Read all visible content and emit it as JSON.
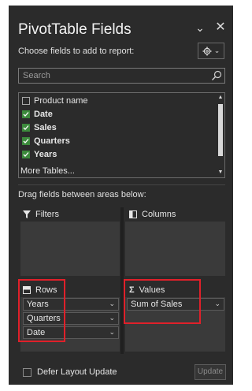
{
  "header": {
    "title": "PivotTable Fields",
    "subtitle": "Choose fields to add to report:"
  },
  "search": {
    "placeholder": "Search"
  },
  "fields": [
    {
      "label": "Product name",
      "checked": false
    },
    {
      "label": "Date",
      "checked": true
    },
    {
      "label": "Sales",
      "checked": true
    },
    {
      "label": "Quarters",
      "checked": true
    },
    {
      "label": "Years",
      "checked": true
    }
  ],
  "more_tables": "More Tables...",
  "drag_instruction": "Drag fields between areas below:",
  "areas": {
    "filters": {
      "label": "Filters"
    },
    "columns": {
      "label": "Columns"
    },
    "rows": {
      "label": "Rows",
      "items": [
        "Years",
        "Quarters",
        "Date"
      ]
    },
    "values": {
      "label": "Values",
      "items": [
        "Sum of Sales"
      ]
    }
  },
  "defer": {
    "label": "Defer Layout Update",
    "checked": false
  },
  "update_button": "Update",
  "colors": {
    "pane_bg": "#2b2b2b",
    "check_green": "#3c8a3c",
    "highlight_red": "#e0202a"
  }
}
